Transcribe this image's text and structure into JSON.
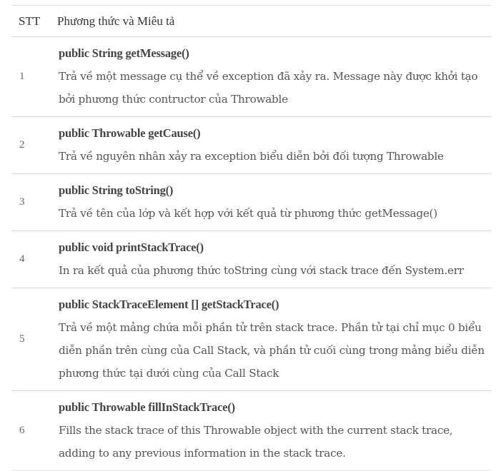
{
  "table": {
    "headers": {
      "stt": "STT",
      "description": "Phương thức và Miêu tả"
    },
    "rows": [
      {
        "number": "1",
        "method": "public String getMessage()",
        "description": "Trả về một message cụ thể về exception đã xảy ra. Message này được khởi tạo bởi phương thức contructor của Throwable"
      },
      {
        "number": "2",
        "method": "public Throwable getCause()",
        "description": "Trả về nguyên nhân xảy ra exception biểu diễn bởi đối tượng Throwable"
      },
      {
        "number": "3",
        "method": "public String toString()",
        "description": "Trả về tên của lớp và kết hợp với kết quả từ phương thức getMessage()"
      },
      {
        "number": "4",
        "method": "public void printStackTrace()",
        "description": "In ra kết quả của phương thức toString cùng với stack trace đến System.err"
      },
      {
        "number": "5",
        "method": "public StackTraceElement [] getStackTrace()",
        "description": "Trả về một mảng chứa mỗi phần tử trên stack trace. Phần tử tại chỉ mục 0 biểu diễn phần trên cùng của Call Stack, và phần tử cuối cùng trong mảng biểu diễn phương thức tại dưới cùng của Call Stack"
      },
      {
        "number": "6",
        "method": "public Throwable fillInStackTrace()",
        "description": "Fills the stack trace of this Throwable object with the current stack trace, adding to any previous information in the stack trace."
      }
    ]
  }
}
